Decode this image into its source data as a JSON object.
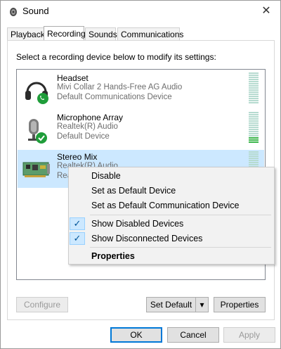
{
  "window": {
    "title": "Sound",
    "close_glyph": "✕"
  },
  "tabs": [
    {
      "label": "Playback"
    },
    {
      "label": "Recording"
    },
    {
      "label": "Sounds"
    },
    {
      "label": "Communications"
    }
  ],
  "active_tab": "Recording",
  "instruction": "Select a recording device below to modify its settings:",
  "devices": [
    {
      "name": "Headset",
      "description": "Mivi Collar 2 Hands-Free AG Audio",
      "status": "Default Communications Device",
      "icon": "headset-icon",
      "badge": "phone-badge",
      "level": 0
    },
    {
      "name": "Microphone Array",
      "description": "Realtek(R) Audio",
      "status": "Default Device",
      "icon": "microphone-icon",
      "badge": "check-badge",
      "level": 0.2
    },
    {
      "name": "Stereo Mix",
      "description": "Realtek(R) Audio",
      "status": "Ready",
      "icon": "sound-card-icon",
      "badge": "",
      "level": 0
    }
  ],
  "context_menu": {
    "items": [
      {
        "label": "Disable",
        "checked": false,
        "bold": false
      },
      {
        "label": "Set as Default Device",
        "checked": false,
        "bold": false
      },
      {
        "label": "Set as Default Communication Device",
        "checked": false,
        "bold": false
      },
      {
        "label": "Show Disabled Devices",
        "checked": true,
        "bold": false
      },
      {
        "label": "Show Disconnected Devices",
        "checked": true,
        "bold": false
      },
      {
        "label": "Properties",
        "checked": false,
        "bold": true
      }
    ],
    "check_glyph": "✓"
  },
  "buttons": {
    "configure": "Configure",
    "set_default": "Set Default",
    "set_default_arrow": "▾",
    "properties": "Properties",
    "ok": "OK",
    "cancel": "Cancel",
    "apply": "Apply"
  },
  "colors": {
    "selection": "#cce8ff",
    "accent": "#0078d7",
    "status_ok": "#1f9d3a"
  }
}
